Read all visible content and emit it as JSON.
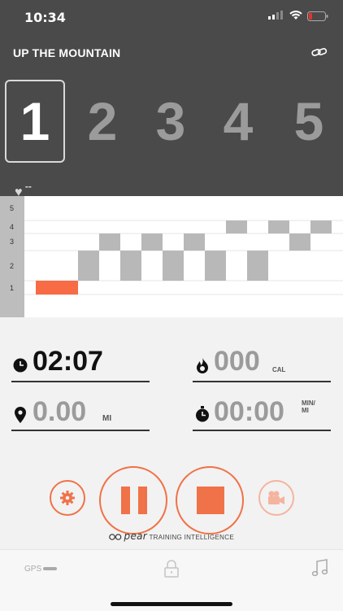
{
  "status_bar": {
    "time": "10:34"
  },
  "header": {
    "title": "UP THE MOUNTAIN"
  },
  "zones": [
    {
      "label": "1",
      "active": true
    },
    {
      "label": "2",
      "active": false
    },
    {
      "label": "3",
      "active": false
    },
    {
      "label": "4",
      "active": false
    },
    {
      "label": "5",
      "active": false
    }
  ],
  "heart_rate": {
    "value": "--"
  },
  "chart_data": {
    "type": "bar",
    "y_axis_labels": [
      "5",
      "4",
      "3",
      "2",
      "1"
    ],
    "zone_timeline": [
      {
        "zone": 1,
        "current": true
      },
      {
        "zone": 2
      },
      {
        "zone": 3
      },
      {
        "zone": 2
      },
      {
        "zone": 3
      },
      {
        "zone": 2
      },
      {
        "zone": 3
      },
      {
        "zone": 2
      },
      {
        "zone": 4
      },
      {
        "zone": 2
      },
      {
        "zone": 4
      },
      {
        "zone": 3
      },
      {
        "zone": 4
      }
    ],
    "colors": {
      "current": "#f76b45",
      "past": "#b8b8b8"
    }
  },
  "metrics": {
    "time": {
      "value": "02:07"
    },
    "calories": {
      "value": "000",
      "unit": "CAL"
    },
    "distance": {
      "value": "0.00",
      "unit": "MI"
    },
    "pace": {
      "value": "00:00",
      "unit_top": "MIN/",
      "unit_bottom": "MI"
    }
  },
  "brand": {
    "name": "pear",
    "tagline": "TRAINING INTELLIGENCE"
  },
  "tabbar": {
    "gps_label": "GPS"
  },
  "colors": {
    "accent": "#f07248",
    "dark": "#4a4a4a"
  }
}
